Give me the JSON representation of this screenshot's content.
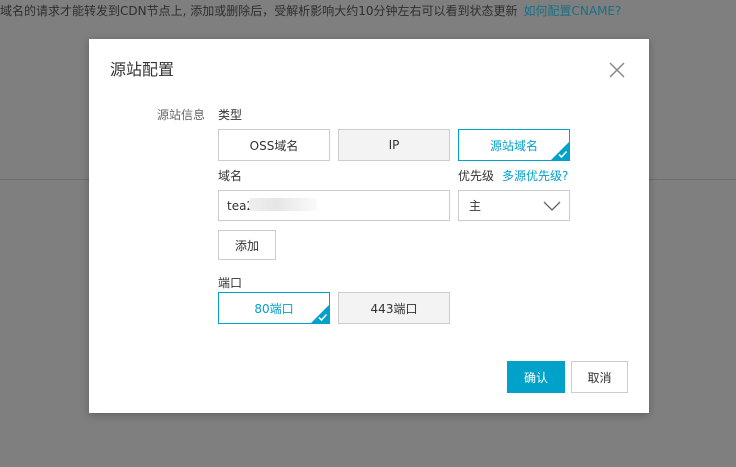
{
  "backdrop": {
    "notice_text": "域名的请求才能转发到CDN节点上, 添加或删除后，受解析影响大约10分钟左右可以看到状态更新",
    "notice_link": "如何配置CNAME?"
  },
  "dialog": {
    "title": "源站配置",
    "section_label": "源站信息",
    "type_label": "类型",
    "type_options": [
      {
        "label": "OSS域名",
        "selected": false
      },
      {
        "label": "IP",
        "selected": false
      },
      {
        "label": "源站域名",
        "selected": true
      }
    ],
    "domain_label": "域名",
    "domain_value": "tea2",
    "priority_label": "优先级",
    "priority_help_link": "多源优先级?",
    "priority_value": "主",
    "add_button": "添加",
    "port_label": "端口",
    "port_options": [
      {
        "label": "80端口",
        "selected": true
      },
      {
        "label": "443端口",
        "selected": false
      }
    ],
    "confirm_button": "确认",
    "cancel_button": "取消"
  },
  "colors": {
    "accent": "#00a2ca",
    "overlay": "#7f7f7f",
    "border": "#cccccc"
  },
  "icons": {
    "close": "close-icon",
    "check": "checkmark-icon",
    "chevron": "chevron-down-icon"
  }
}
